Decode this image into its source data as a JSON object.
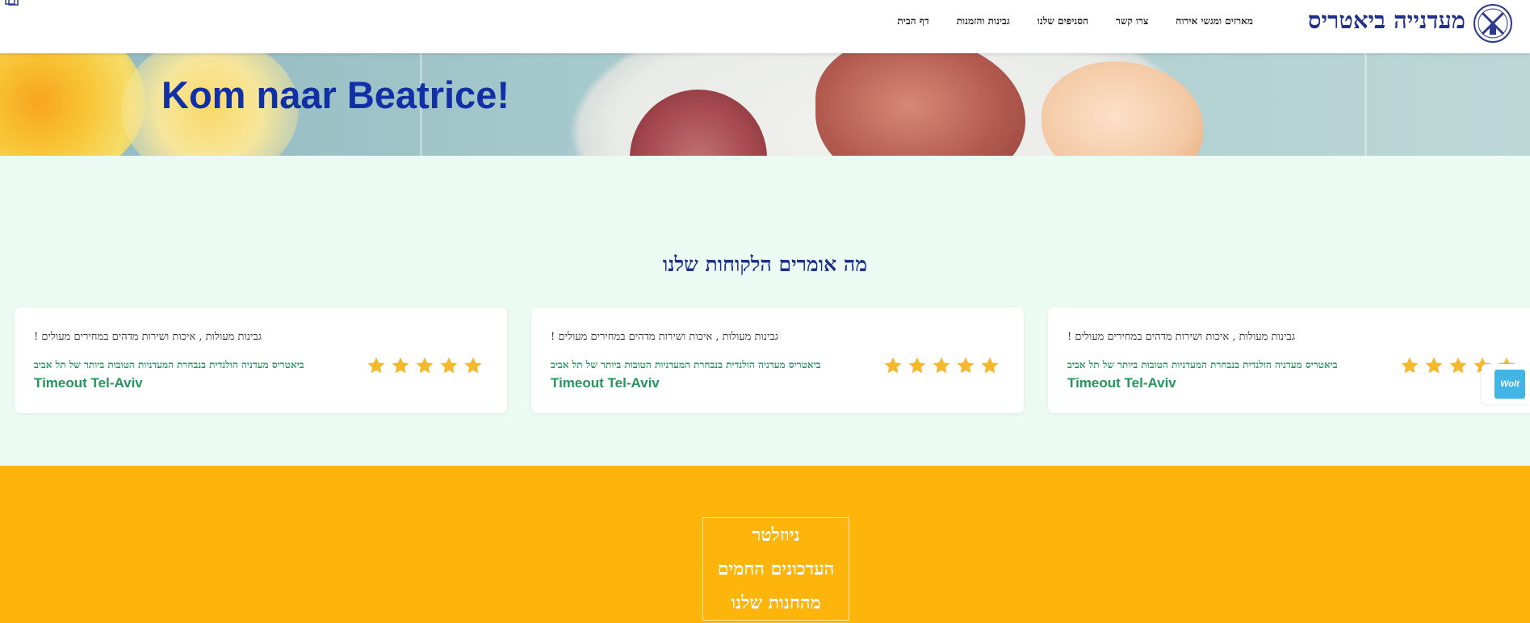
{
  "header": {
    "brand": "מעדנייה ביאטריס",
    "nav": [
      {
        "label": "דף הבית"
      },
      {
        "label": "גבינות והזמנות"
      },
      {
        "label": "הסניפים שלנו"
      },
      {
        "label": "צרו קשר"
      },
      {
        "label": "מארזים ומגשי אירוח"
      }
    ]
  },
  "hero": {
    "title": "Kom naar Beatrice!"
  },
  "reviews": {
    "title": "מה אומרים הלקוחות שלנו",
    "items": [
      {
        "quote": "גבינות מעולות , איכות ושירות מדהים במחירים מעולים !",
        "description": "ביאטריס מעדניה הולנדית בנבחרת המעדניות הטובות ביותר של תל אביב",
        "source": "Timeout Tel-Aviv",
        "rating": 5
      },
      {
        "quote": "גבינות מעולות , איכות ושירות מדהים במחירים מעולים !",
        "description": "ביאטריס מעדניה הולנדית בנבחרת המעדניות הטובות ביותר של תל אביב",
        "source": "Timeout Tel-Aviv",
        "rating": 5
      },
      {
        "quote": "גבינות מעולות , איכות ושירות מדהים במחירים מעולים !",
        "description": "ביאטריס מעדניה הולנדית בנבחרת המעדניות הטובות ביותר של תל אביב",
        "source": "Timeout Tel-Aviv",
        "rating": 5
      }
    ]
  },
  "wolt": {
    "label": "Wolt"
  },
  "newsletter": {
    "lines": [
      "ניוזלטר",
      "העדכונים החמים",
      "מהחנות שלנו"
    ]
  },
  "colors": {
    "brand": "#1f2f8a",
    "hero_title": "#1230a6",
    "accent_green": "#23965a",
    "star": "#f5b82e",
    "newsletter_bg": "#feb50b",
    "reviews_bg": "#ebfaf3"
  }
}
